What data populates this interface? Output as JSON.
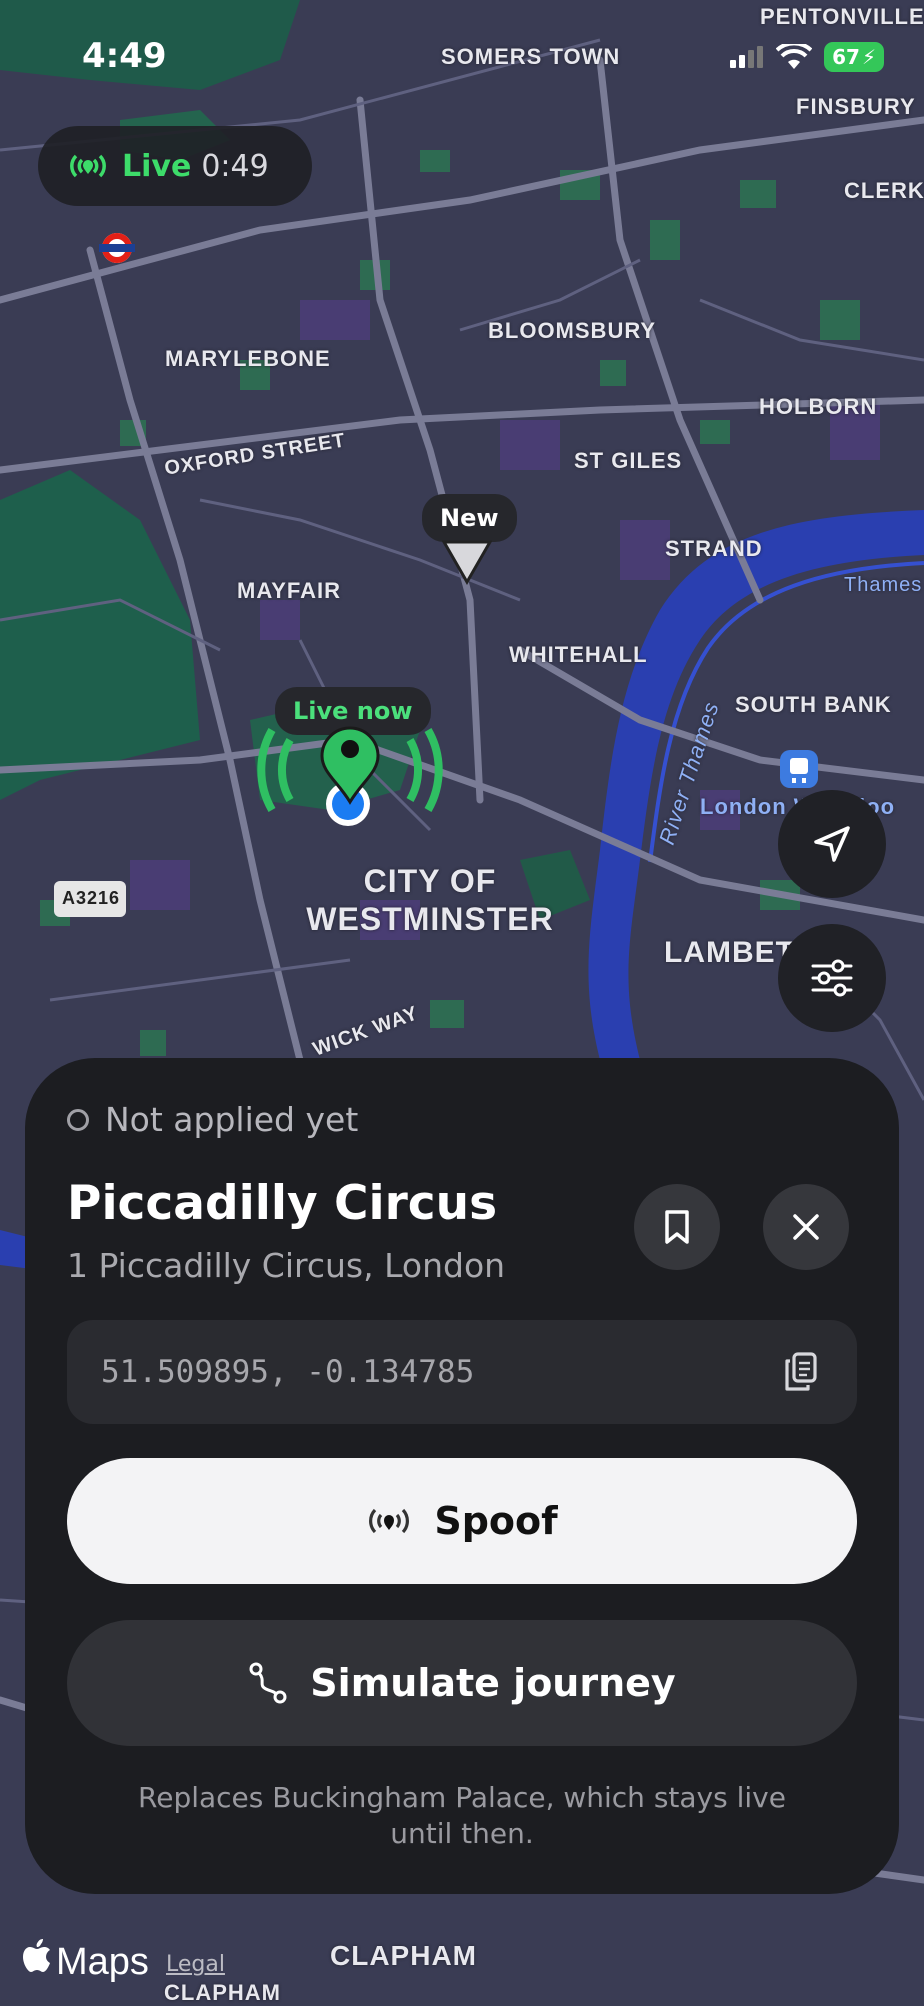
{
  "status_bar": {
    "time": "4:49",
    "battery": "67"
  },
  "live_pill": {
    "label": "Live",
    "timer": "0:49"
  },
  "map": {
    "labels": {
      "pentonville": "PENTONVILLE",
      "somers_town": "SOMERS TOWN",
      "finsbury": "FINSBURY",
      "clerke": "CLERKE",
      "marylebone": "MARYLEBONE",
      "bloomsbury": "BLOOMSBURY",
      "holborn": "HOLBORN",
      "oxford_street": "OXFORD STREET",
      "st_giles": "ST GILES",
      "strand": "STRAND",
      "mayfair": "MAYFAIR",
      "whitehall": "WHITEHALL",
      "thames": "Thames",
      "south_bank": "SOUTH BANK",
      "river_thames": "River Thames",
      "london_waterloo": "London Waterloo",
      "city_of_westminster_1": "CITY OF",
      "city_of_westminster_2": "WESTMINSTER",
      "lambeth": "LAMBETH",
      "a3216": "A3216",
      "wick_way": "WICK WAY",
      "clapham": "CLAPHAM",
      "clapham_2": "CLAPHAM"
    },
    "new_pin_label": "New",
    "live_now_label": "Live now"
  },
  "sheet": {
    "status": "Not applied yet",
    "title": "Piccadilly Circus",
    "address": "1 Piccadilly Circus, London",
    "coordinates": "51.509895, -0.134785",
    "primary_button": "Spoof",
    "secondary_button": "Simulate journey",
    "footnote": "Replaces Buckingham Palace, which stays live until then."
  },
  "brand": {
    "maps": "Maps",
    "legal": "Legal"
  }
}
